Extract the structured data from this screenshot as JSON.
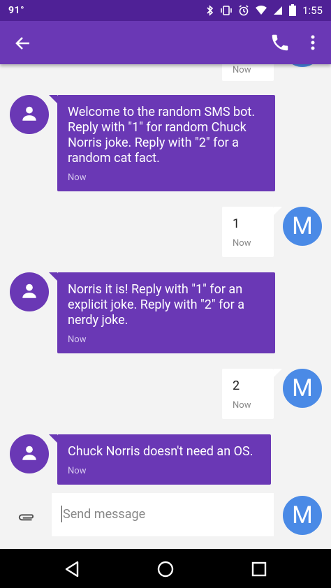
{
  "status_bar": {
    "temperature": "91°",
    "time": "1:55",
    "battery": "90"
  },
  "app_bar": {
    "back_icon": "arrow-back-icon",
    "call_icon": "phone-icon",
    "menu_icon": "more-vert-icon"
  },
  "conversation": {
    "partial_top_timestamp": "Now",
    "messages": [
      {
        "from": "bot",
        "text": "Welcome to the random SMS bot. Reply with \"1\" for random Chuck Norris joke. Reply with \"2\" for a random cat fact.",
        "time": "Now"
      },
      {
        "from": "me",
        "text": "1",
        "time": "Now",
        "avatar_letter": "M"
      },
      {
        "from": "bot",
        "text": "Norris it is! Reply with \"1\" for an explicit joke. Reply with \"2\" for a nerdy joke.",
        "time": "Now"
      },
      {
        "from": "me",
        "text": "2",
        "time": "Now",
        "avatar_letter": "M"
      },
      {
        "from": "bot",
        "text": "Chuck Norris doesn't need an OS.",
        "time": "Now"
      }
    ]
  },
  "composer": {
    "placeholder": "Send message",
    "avatar_letter": "M"
  },
  "colors": {
    "status_bar": "#4f2196",
    "app_bar": "#6a38b5",
    "incoming_bubble": "#6a38b5",
    "my_avatar": "#4a8ae6"
  }
}
